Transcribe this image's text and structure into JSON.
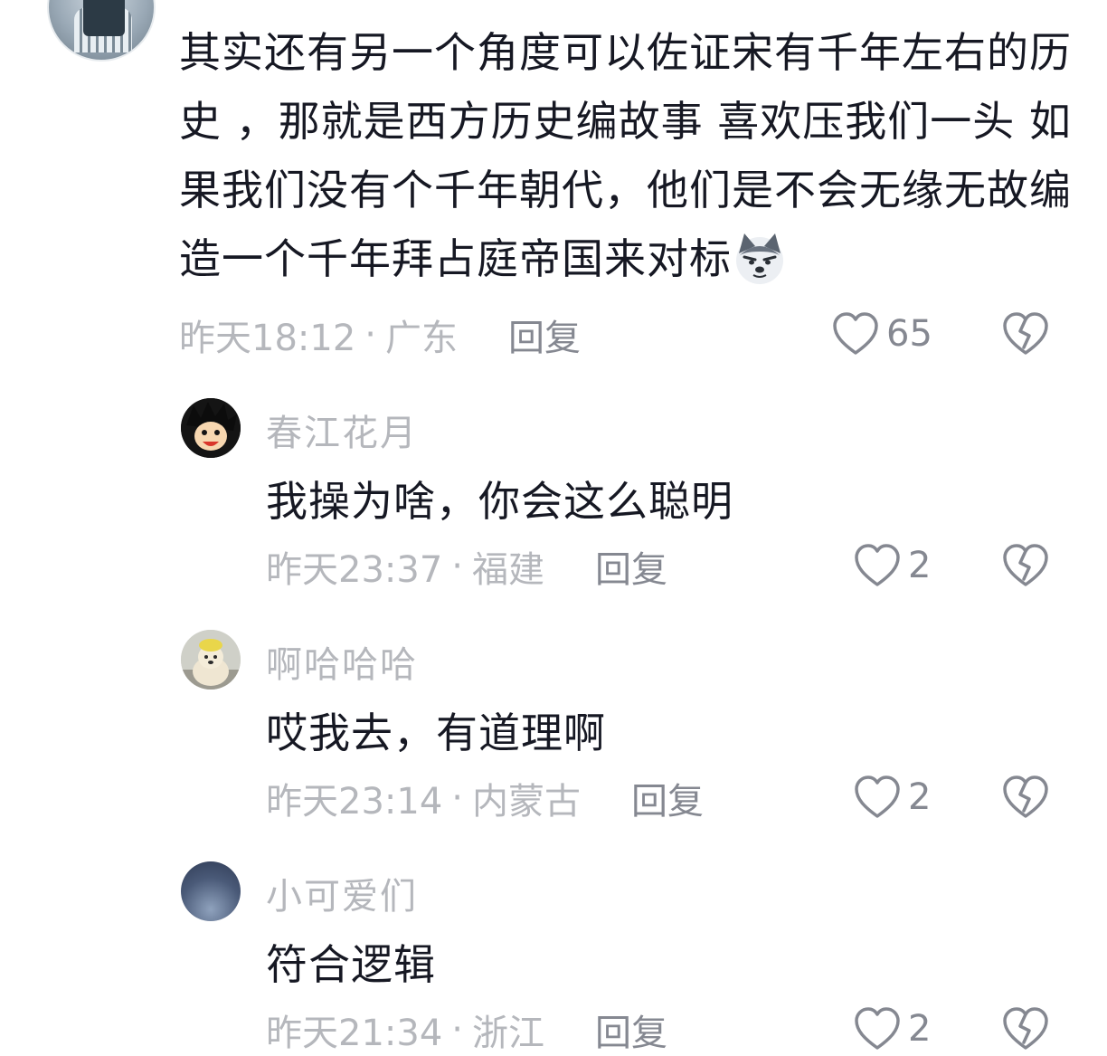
{
  "main_comment": {
    "text": "其实还有另一个角度可以佐证宋有千年左右的历史 ，那就是西方历史编故事 喜欢压我们一头 如果我们没有个千年朝代，他们是不会无缘无故编造一个千年拜占庭帝国来对标",
    "emoji": "doge-emoji",
    "time": "昨天18:12",
    "location": "广东",
    "reply_label": "回复",
    "likes": "65"
  },
  "replies": [
    {
      "name": "春江花月",
      "text": "我操为啥，你会这么聪明",
      "time": "昨天23:37",
      "location": "福建",
      "reply_label": "回复",
      "likes": "2"
    },
    {
      "name": "啊哈哈哈",
      "text": "哎我去，有道理啊",
      "time": "昨天23:14",
      "location": "内蒙古",
      "reply_label": "回复",
      "likes": "2"
    },
    {
      "name": "小可爱们",
      "text": "符合逻辑",
      "time": "昨天21:34",
      "location": "浙江",
      "reply_label": "回复",
      "likes": "2"
    }
  ],
  "separator": "·",
  "colors": {
    "text": "#161823",
    "meta": "#b5b7bc",
    "reply": "#858891"
  }
}
